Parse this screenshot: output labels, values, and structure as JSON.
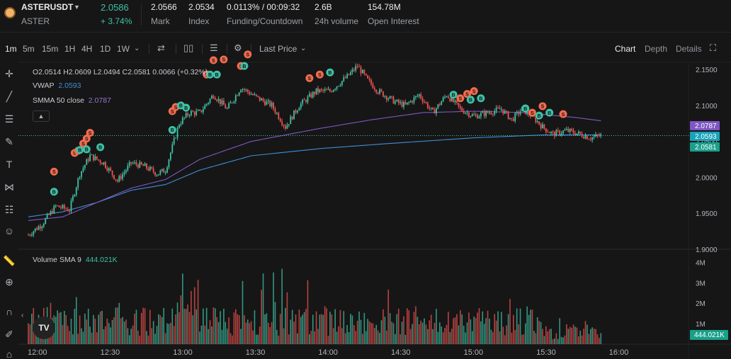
{
  "header": {
    "symbol": "ASTERUSDT",
    "base": "ASTER",
    "last_price": "2.0586",
    "change_pct": "+ 3.74%",
    "stats": [
      {
        "value": "2.0566",
        "label": "Mark"
      },
      {
        "value": "2.0534",
        "label": "Index"
      },
      {
        "value": "0.0113% / 00:09:32",
        "label": "Funding/Countdown"
      },
      {
        "value": "2.6B",
        "label": "24h volume"
      },
      {
        "value": "154.78M",
        "label": "Open Interest"
      }
    ]
  },
  "toolbar": {
    "timeframes": [
      "1m",
      "5m",
      "15m",
      "1H",
      "4H",
      "1D",
      "1W"
    ],
    "active_timeframe": "1m",
    "price_source": "Last Price",
    "views": [
      "Chart",
      "Depth",
      "Details"
    ],
    "active_view": "Chart"
  },
  "legend": {
    "ohlc": "O2.0514  H2.0609  L2.0494  C2.0581  0.0066 (+0.32%)",
    "vwap_label": "VWAP",
    "vwap_value": "2.0593",
    "smma_label": "SMMA 50 close",
    "smma_value": "2.0787",
    "volume_label": "Volume SMA 9",
    "volume_value": "444.021K"
  },
  "colors": {
    "up": "#3ec1a6",
    "down": "#ef5350",
    "vwap": "#3d8fd6",
    "smma": "#7e57c2",
    "buy_marker": "#3ec1a6",
    "sell_marker": "#f26b4f"
  },
  "chart_data": {
    "type": "candlestick",
    "symbol": "ASTERUSDT",
    "interval": "1m",
    "price_axis": {
      "ticks": [
        "2.1500",
        "2.1000",
        "2.0500",
        "2.0000",
        "1.9500",
        "1.9000"
      ],
      "range": [
        1.9,
        2.16
      ]
    },
    "volume_axis": {
      "ticks": [
        "4M",
        "3M",
        "2M",
        "1M"
      ],
      "range": [
        0,
        4.5
      ]
    },
    "time_axis": {
      "ticks": [
        "12:00",
        "12:30",
        "13:00",
        "13:30",
        "14:00",
        "14:30",
        "15:00",
        "15:30",
        "16:00"
      ]
    },
    "price_labels": [
      {
        "value": "2.0787",
        "series": "SMMA 50 close"
      },
      {
        "value": "2.0593",
        "series": "VWAP"
      },
      {
        "value": "2.0581",
        "series": "Last"
      }
    ],
    "volume_label": "444.021K",
    "close_anchors": [
      [
        0,
        1.92
      ],
      [
        8,
        1.935
      ],
      [
        16,
        1.96
      ],
      [
        24,
        1.955
      ],
      [
        30,
        2.005
      ],
      [
        36,
        2.03
      ],
      [
        44,
        2.02
      ],
      [
        52,
        1.995
      ],
      [
        60,
        2.02
      ],
      [
        68,
        2.015
      ],
      [
        75,
        2.005
      ],
      [
        80,
        2.01
      ],
      [
        88,
        2.075
      ],
      [
        94,
        2.09
      ],
      [
        100,
        2.09
      ],
      [
        108,
        2.115
      ],
      [
        116,
        2.095
      ],
      [
        124,
        2.125
      ],
      [
        134,
        2.11
      ],
      [
        142,
        2.1
      ],
      [
        150,
        2.07
      ],
      [
        158,
        2.1
      ],
      [
        168,
        2.12
      ],
      [
        176,
        2.12
      ],
      [
        186,
        2.14
      ],
      [
        192,
        2.155
      ],
      [
        198,
        2.135
      ],
      [
        204,
        2.12
      ],
      [
        214,
        2.105
      ],
      [
        220,
        2.1
      ],
      [
        228,
        2.115
      ],
      [
        236,
        2.09
      ],
      [
        244,
        2.115
      ],
      [
        252,
        2.095
      ],
      [
        260,
        2.085
      ],
      [
        268,
        2.09
      ],
      [
        276,
        2.095
      ],
      [
        282,
        2.08
      ],
      [
        288,
        2.095
      ],
      [
        294,
        2.085
      ],
      [
        300,
        2.07
      ],
      [
        306,
        2.06
      ],
      [
        314,
        2.065
      ],
      [
        322,
        2.06
      ],
      [
        328,
        2.055
      ],
      [
        334,
        2.058
      ]
    ],
    "vwap_anchors": [
      [
        0,
        1.945
      ],
      [
        20,
        1.952
      ],
      [
        40,
        1.965
      ],
      [
        60,
        1.982
      ],
      [
        80,
        1.99
      ],
      [
        100,
        2.01
      ],
      [
        130,
        2.03
      ],
      [
        170,
        2.04
      ],
      [
        210,
        2.047
      ],
      [
        260,
        2.055
      ],
      [
        300,
        2.059
      ],
      [
        334,
        2.059
      ]
    ],
    "smma_anchors": [
      [
        0,
        1.94
      ],
      [
        20,
        1.945
      ],
      [
        40,
        1.965
      ],
      [
        60,
        1.985
      ],
      [
        80,
        1.997
      ],
      [
        100,
        2.025
      ],
      [
        130,
        2.05
      ],
      [
        170,
        2.068
      ],
      [
        200,
        2.08
      ],
      [
        230,
        2.09
      ],
      [
        260,
        2.092
      ],
      [
        290,
        2.09
      ],
      [
        320,
        2.083
      ],
      [
        334,
        2.0787
      ]
    ],
    "trade_markers": [
      {
        "t": 15,
        "p": 2.008,
        "side": "S"
      },
      {
        "t": 15,
        "p": 1.98,
        "side": "B"
      },
      {
        "t": 27,
        "p": 2.034,
        "side": "S"
      },
      {
        "t": 29,
        "p": 2.037,
        "side": "S"
      },
      {
        "t": 30,
        "p": 2.038,
        "side": "B"
      },
      {
        "t": 32,
        "p": 2.047,
        "side": "S"
      },
      {
        "t": 34,
        "p": 2.054,
        "side": "S"
      },
      {
        "t": 36,
        "p": 2.062,
        "side": "S"
      },
      {
        "t": 34,
        "p": 2.039,
        "side": "B"
      },
      {
        "t": 42,
        "p": 2.042,
        "side": "B"
      },
      {
        "t": 84,
        "p": 2.092,
        "side": "S"
      },
      {
        "t": 86,
        "p": 2.098,
        "side": "S"
      },
      {
        "t": 89,
        "p": 2.1,
        "side": "B"
      },
      {
        "t": 92,
        "p": 2.097,
        "side": "B"
      },
      {
        "t": 84,
        "p": 2.066,
        "side": "B"
      },
      {
        "t": 104,
        "p": 2.143,
        "side": "S"
      },
      {
        "t": 106,
        "p": 2.143,
        "side": "B"
      },
      {
        "t": 110,
        "p": 2.143,
        "side": "B"
      },
      {
        "t": 108,
        "p": 2.163,
        "side": "S"
      },
      {
        "t": 114,
        "p": 2.164,
        "side": "S"
      },
      {
        "t": 124,
        "p": 2.155,
        "side": "S"
      },
      {
        "t": 126,
        "p": 2.155,
        "side": "B"
      },
      {
        "t": 128,
        "p": 2.171,
        "side": "S"
      },
      {
        "t": 164,
        "p": 2.138,
        "side": "S"
      },
      {
        "t": 170,
        "p": 2.143,
        "side": "S"
      },
      {
        "t": 176,
        "p": 2.146,
        "side": "B"
      },
      {
        "t": 248,
        "p": 2.115,
        "side": "B"
      },
      {
        "t": 252,
        "p": 2.11,
        "side": "S"
      },
      {
        "t": 256,
        "p": 2.116,
        "side": "S"
      },
      {
        "t": 260,
        "p": 2.12,
        "side": "S"
      },
      {
        "t": 264,
        "p": 2.11,
        "side": "B"
      },
      {
        "t": 258,
        "p": 2.108,
        "side": "B"
      },
      {
        "t": 290,
        "p": 2.096,
        "side": "B"
      },
      {
        "t": 294,
        "p": 2.09,
        "side": "S"
      },
      {
        "t": 298,
        "p": 2.086,
        "side": "B"
      },
      {
        "t": 300,
        "p": 2.099,
        "side": "S"
      },
      {
        "t": 304,
        "p": 2.09,
        "side": "B"
      },
      {
        "t": 312,
        "p": 2.088,
        "side": "S"
      }
    ]
  }
}
